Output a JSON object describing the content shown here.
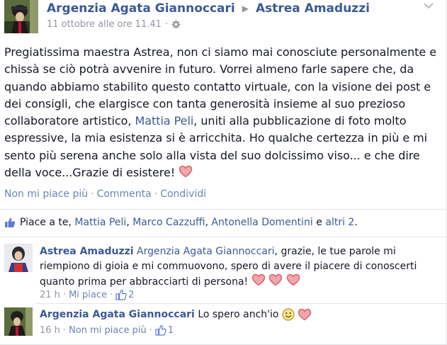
{
  "post": {
    "author": "Argenzia Agata Giannoccari",
    "target": "Astrea Amaduzzi",
    "timestamp": "11 ottobre alle ore 11.41",
    "privacy_icon": "gear-icon",
    "text_main": "Pregiatissima maestra Astrea, non ci siamo mai conosciute personalmente e chissà se ciò potrà avvenire in futuro. Vorrei almeno farle sapere che, da quando abbiamo stabilito questo contatto virtuale, con la visione dei post e dei consigli, che elargisce con tanta generosità insieme al suo prezioso collaboratore artistico, ",
    "text_mention": "Mattia Peli",
    "text_tail": ", uniti alla pubblicazione di foto molto espressive, la mia esistenza si è arricchita. Ho qualche certezza in più e mi sento più serena anche solo alla vista del suo dolcissimo viso... e che dire della voce...Grazie di esistere!",
    "heart_color": "#e2747b"
  },
  "actions": {
    "unlike": "Non mi piace più",
    "comment": "Commenta",
    "share": "Condividi",
    "separator": "·"
  },
  "likes": {
    "prefix": "Piace a te,",
    "names": [
      "Mattia Peli",
      "Marco Cazzuffi",
      "Antonella Domentini"
    ],
    "connector": "e",
    "others": "altri 2",
    "end": "."
  },
  "comments": [
    {
      "author": "Astrea Amaduzzi",
      "mention": "Argenzia Agata Giannoccari",
      "text": ", grazie, le tue parole mi riempiono di gioia e mi commuovono, spero di avere il piacere di conoscerti quanto prima per abbracciarti di persona!",
      "time": "21 h",
      "like_label": "Mi piace",
      "like_count": "2"
    },
    {
      "author": "Argenzia Agata Giannoccari",
      "text": "Lo spero anch'io",
      "time": "16 h",
      "like_label": "Non mi piace più",
      "like_count": "1"
    }
  ],
  "colors": {
    "link": "#3b5998",
    "muted": "#9197a3",
    "action": "#6d84b4"
  }
}
